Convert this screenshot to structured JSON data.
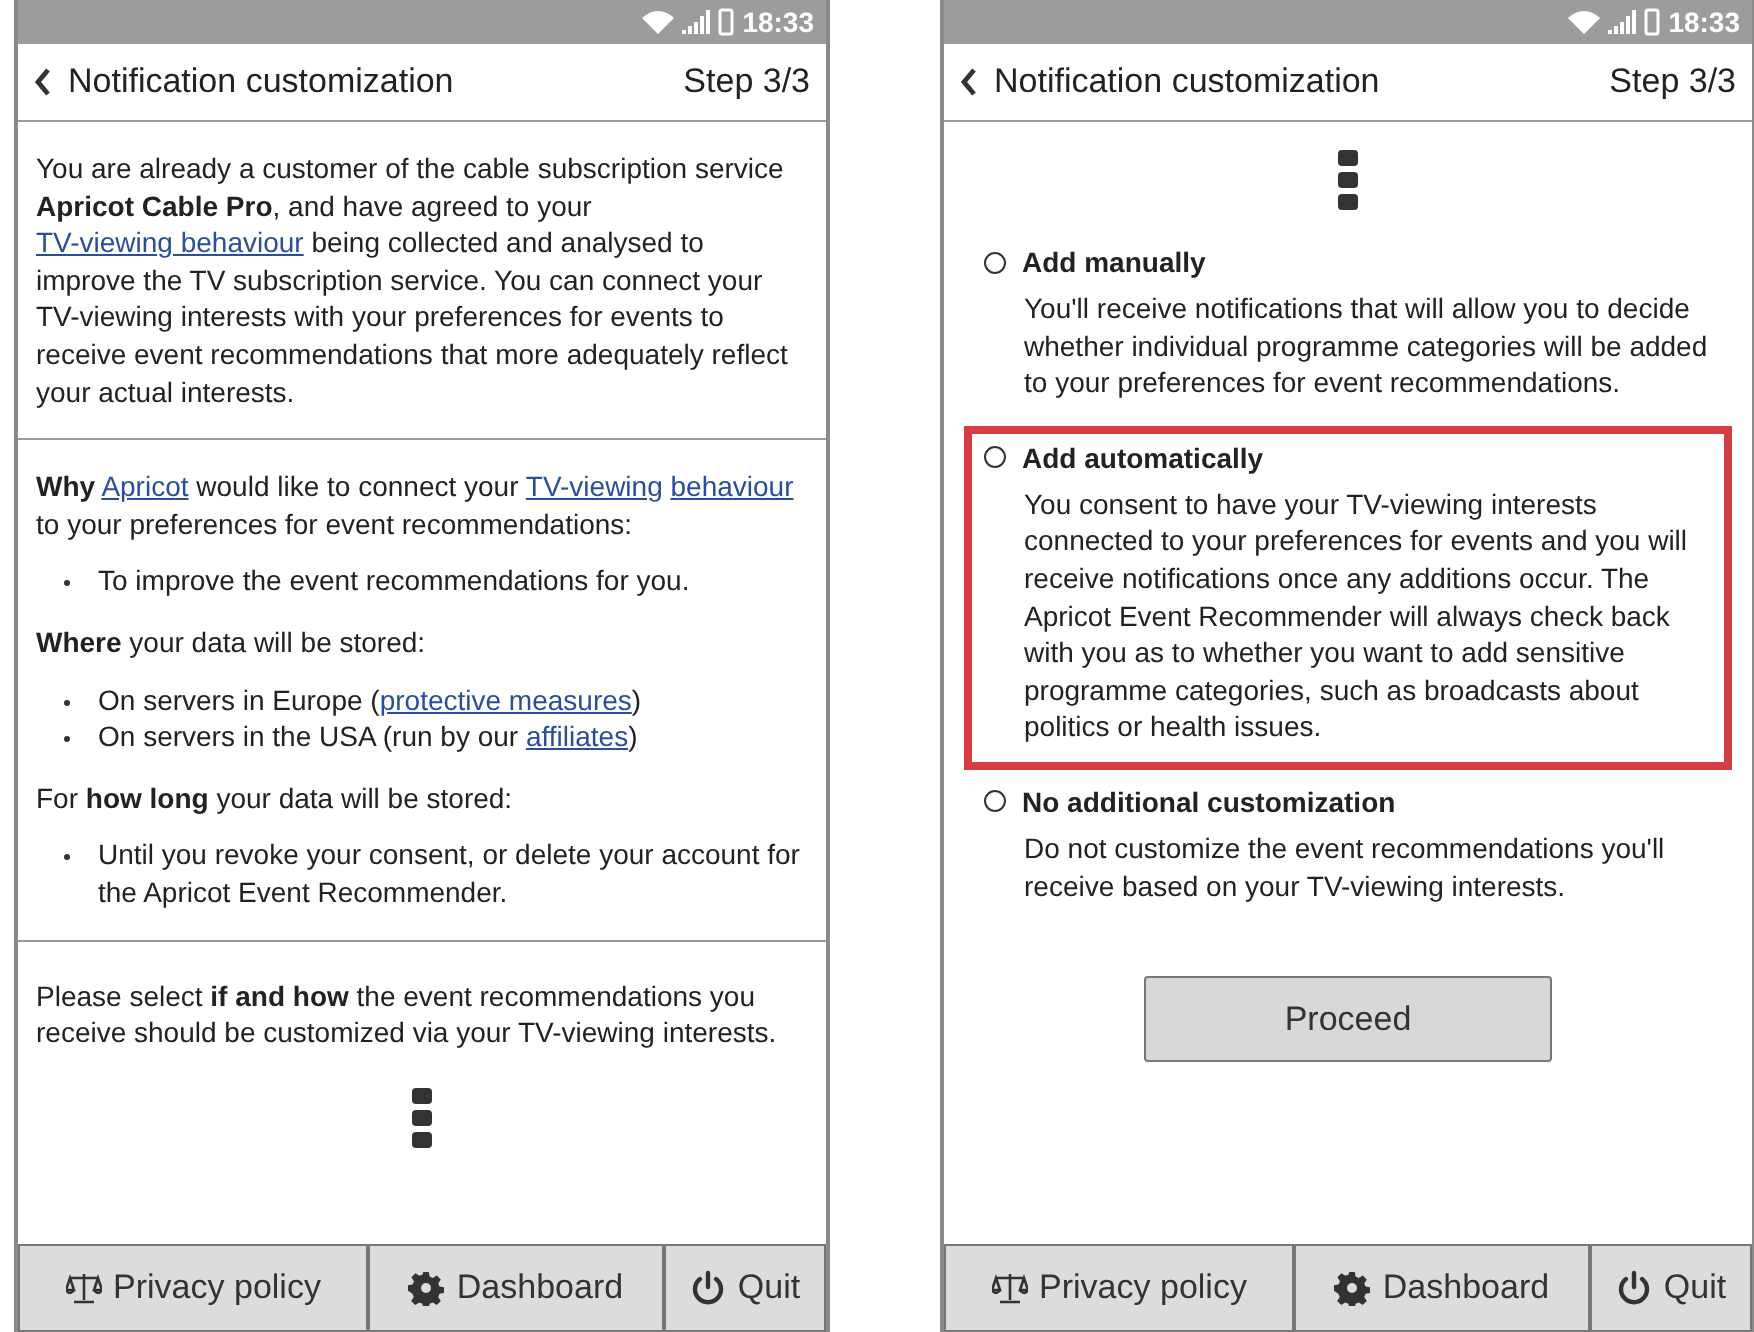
{
  "screens": [
    {
      "status_bar": {
        "time": "18:33"
      },
      "header": {
        "title": "Notification customization",
        "step": "Step 3/3"
      },
      "kind": "info",
      "sections": [
        {
          "blocks": [
            {
              "kind": "paragraph",
              "segments": [
                {
                  "kind": "text",
                  "text": "You are already a customer of the cable subscription service **Apricot Cable Pro**, and have agreed to your "
                },
                {
                  "kind": "link",
                  "text": "TV-viewing behaviour"
                },
                {
                  "kind": "text",
                  "text": " being collected and analysed to improve the TV subscription service. You can connect your TV-viewing interests with your preferences for events to receive event recommendations that more adequately reflect your actual interests."
                }
              ]
            }
          ]
        },
        {
          "blocks": [
            {
              "kind": "paragraph",
              "segments": [
                {
                  "kind": "text",
                  "text": "**Why** "
                },
                {
                  "kind": "link",
                  "text": "Apricot"
                },
                {
                  "kind": "text",
                  "text": " would like to connect your "
                },
                {
                  "kind": "link",
                  "text": "TV-viewing"
                },
                {
                  "kind": "link",
                  "text": "behaviour"
                },
                {
                  "kind": "text",
                  "text": " to your preferences for event recommendations:"
                }
              ]
            },
            {
              "kind": "bullet",
              "segments": [
                {
                  "kind": "text",
                  "text": "To improve the event recommendations for you."
                }
              ]
            },
            {
              "kind": "paragraph",
              "segments": [
                {
                  "kind": "text",
                  "text": "**Where** your data will be stored:"
                }
              ]
            },
            {
              "kind": "bullet",
              "segments": [
                {
                  "kind": "text",
                  "text": "On servers in Europe ("
                },
                {
                  "kind": "link",
                  "text": "protective measures"
                },
                {
                  "kind": "text",
                  "text": ")"
                }
              ]
            },
            {
              "kind": "bullet",
              "segments": [
                {
                  "kind": "text",
                  "text": "On servers in the USA (run by our "
                },
                {
                  "kind": "link",
                  "text": "affiliates"
                },
                {
                  "kind": "text",
                  "text": ")"
                }
              ]
            },
            {
              "kind": "paragraph",
              "segments": [
                {
                  "kind": "text",
                  "text": "For **how long** your data will be stored:"
                }
              ]
            },
            {
              "kind": "bullet",
              "segments": [
                {
                  "kind": "text",
                  "text": "Until you revoke your consent, or delete your account for the Apricot Event Recommender."
                }
              ]
            }
          ]
        },
        {
          "blocks": [
            {
              "kind": "paragraph",
              "segments": [
                {
                  "kind": "text",
                  "text": "Please select **if and how** the event recommendations you receive should be customized via your TV-viewing interests."
                }
              ]
            },
            {
              "kind": "more"
            }
          ]
        }
      ],
      "footer": [
        {
          "kind": "privacy",
          "label": "Privacy policy"
        },
        {
          "kind": "dashboard",
          "label": "Dashboard"
        },
        {
          "kind": "quit",
          "label": "Quit"
        }
      ]
    },
    {
      "status_bar": {
        "time": "18:33"
      },
      "header": {
        "title": "Notification customization",
        "step": "Step 3/3"
      },
      "kind": "options",
      "options": [
        {
          "label": "Add manually",
          "description": "You'll receive notifications that will allow you to decide whether individual programme categories will be added to your preferences for event recommendations.",
          "selected": false,
          "highlighted": false
        },
        {
          "label": "Add automatically",
          "description": "You consent to have your TV-viewing interests connected to your preferences for events and you will receive notifications once any additions occur. The Apricot Event Recommender will always check back with you as to whether you want to add sensitive programme categories, such as broadcasts about politics or health issues.",
          "selected": false,
          "highlighted": true
        },
        {
          "label": "No additional customization",
          "description": "Do not customize the event recommendations you'll receive based on your TV-viewing interests.",
          "selected": false,
          "highlighted": false
        }
      ],
      "proceed": "Proceed",
      "footer": [
        {
          "kind": "privacy",
          "label": "Privacy policy"
        },
        {
          "kind": "dashboard",
          "label": "Dashboard"
        },
        {
          "kind": "quit",
          "label": "Quit"
        }
      ]
    }
  ]
}
